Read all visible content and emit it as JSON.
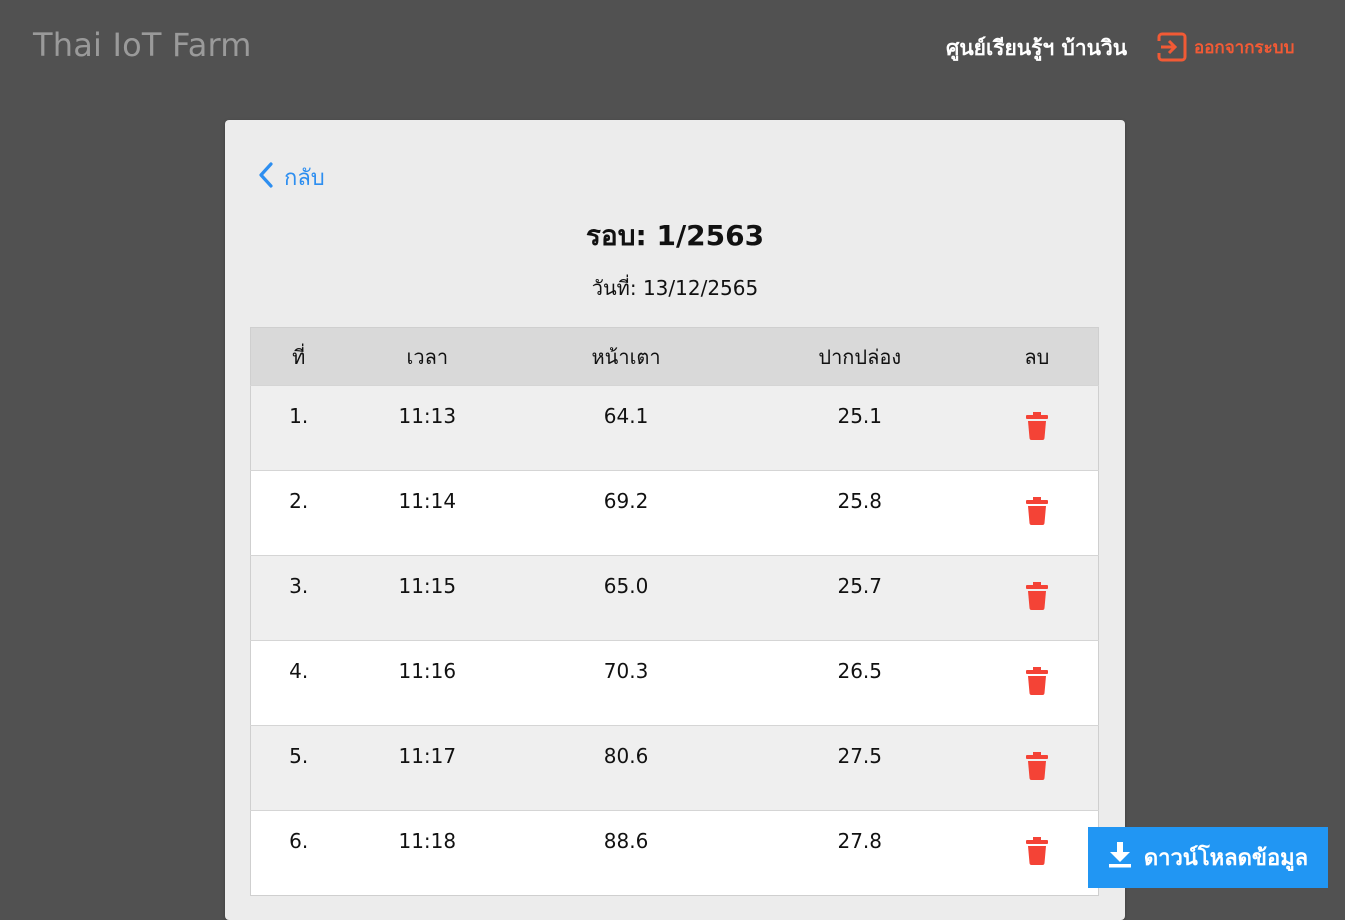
{
  "header": {
    "brand": "Thai IoT Farm",
    "center_name": "ศูนย์เรียนรู้ฯ บ้านวิน",
    "logout_label": "ออกจากระบบ",
    "accent_color": "#f25a35"
  },
  "card": {
    "back_label": "กลับ",
    "title": "รอบ: 1/2563",
    "date": "วันที่: 13/12/2565"
  },
  "table": {
    "headers": [
      "ที่",
      "เวลา",
      "หน้าเตา",
      "ปากปล่อง",
      "ลบ"
    ],
    "rows": [
      {
        "no": "1.",
        "time": "11:13",
        "a": "64.1",
        "b": "25.1"
      },
      {
        "no": "2.",
        "time": "11:14",
        "a": "69.2",
        "b": "25.8"
      },
      {
        "no": "3.",
        "time": "11:15",
        "a": "65.0",
        "b": "25.7"
      },
      {
        "no": "4.",
        "time": "11:16",
        "a": "70.3",
        "b": "26.5"
      },
      {
        "no": "5.",
        "time": "11:17",
        "a": "80.6",
        "b": "27.5"
      },
      {
        "no": "6.",
        "time": "11:18",
        "a": "88.6",
        "b": "27.8"
      }
    ],
    "delete_icon": "trash-icon",
    "delete_color": "#f44336"
  },
  "download": {
    "label": "ดาวน์โหลดข้อมูล",
    "icon": "download-icon",
    "color": "#2196f3"
  }
}
